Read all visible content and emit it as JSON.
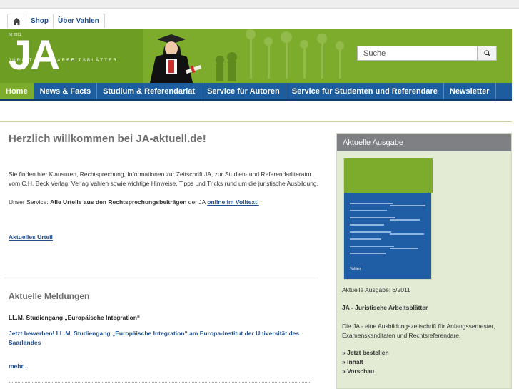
{
  "util_nav": {
    "shop": "Shop",
    "about": "Über Vahlen"
  },
  "header": {
    "issue": "6 | 2011",
    "logo": "JA",
    "tagline": "JURISTISCHE ARBEITSBLÄTTER",
    "search_placeholder": "Suche"
  },
  "main_nav": [
    "Home",
    "News & Facts",
    "Studium & Referendariat",
    "Service für Autoren",
    "Service für Studenten und Referendare",
    "Newsletter"
  ],
  "content": {
    "title": "Herzlich willkommen bei JA-aktuell.de!",
    "intro": "Sie finden hier Klausuren, Rechtsprechung, Informationen zur Zeitschrift JA, zur Studien- und Referendarliteratur vom C.H. Beck Verlag, Verlag Vahlen sowie wichtige Hinweise, Tipps und Tricks rund um die juristische Ausbildung.",
    "service_prefix": "Unser Service: ",
    "service_bold": "Alle Urteile aus den Rechtsprechungsbeiträgen",
    "service_mid": " der JA ",
    "service_link": "online im Volltext!",
    "current_ruling": "Aktuelles Urteil",
    "news_title": "Aktuelle Meldungen",
    "news_item_title": "LL.M. Studiengang „Europäische Integration“",
    "news_item_link": "Jetzt bewerben! LL.M. Studiengang „Europäische Integration“ am Europa-Institut der Universität des Saarlandes",
    "more": "mehr..."
  },
  "sidebar": {
    "head": "Aktuelle Ausgabe",
    "issue_line": "Aktuelle Ausgabe: 6/2011",
    "journal": "JA - Juristische Arbeitsblätter",
    "description": "Die JA - eine Ausbildungszeitschrift für Anfangssemester, Examenskanditaten und Rechtsreferendare.",
    "links": [
      "» Jetzt bestellen",
      "» Inhalt",
      "» Vorschau"
    ],
    "cover_publisher": "Vahlen"
  }
}
